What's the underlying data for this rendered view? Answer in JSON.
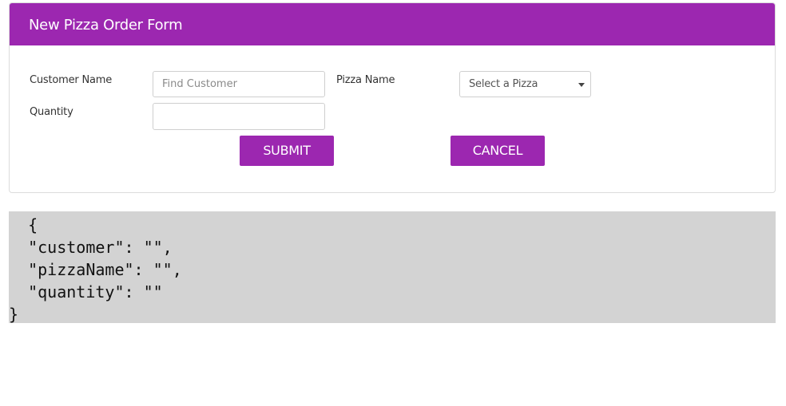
{
  "form": {
    "title": "New Pizza Order Form",
    "customer_label": "Customer Name",
    "customer_placeholder": "Find Customer",
    "customer_value": "",
    "pizza_label": "Pizza Name",
    "pizza_select_placeholder": "Select a Pizza",
    "quantity_label": "Quantity",
    "quantity_value": "",
    "submit_label": "SUBMIT",
    "cancel_label": "CANCEL"
  },
  "colors": {
    "accent": "#9c27b0",
    "json_background": "#d3d3d3"
  },
  "json_output": "  {\n  \"customer\": \"\",\n  \"pizzaName\": \"\",\n  \"quantity\": \"\"\n}"
}
